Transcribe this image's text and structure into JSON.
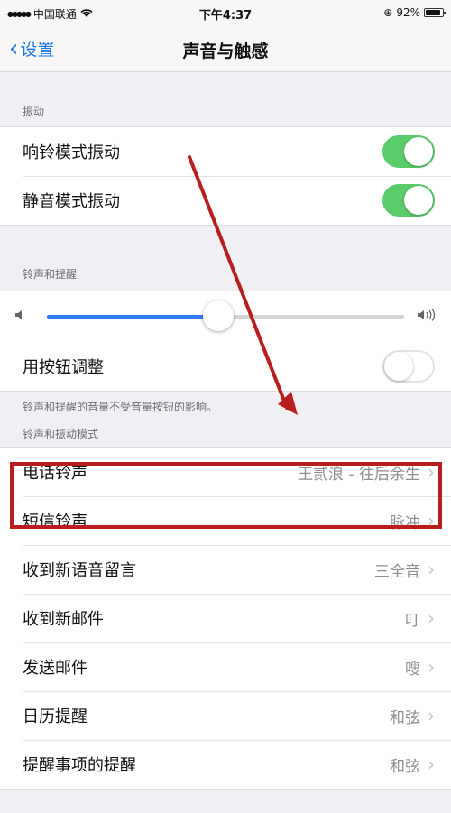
{
  "status_bar": {
    "carrier": "中国联通",
    "time": "下午4:37",
    "battery": "92%"
  },
  "nav": {
    "back_label": "设置",
    "title": "声音与触感"
  },
  "vibrate_section": {
    "header": "振动",
    "items": [
      {
        "label": "响铃模式振动",
        "state": "on"
      },
      {
        "label": "静音模式振动",
        "state": "on"
      }
    ]
  },
  "ringer_section": {
    "header": "铃声和提醒",
    "volume_level": 0.48,
    "adjust_label": "用按钮调整",
    "adjust_state": "off",
    "footer": "铃声和提醒的音量不受音量按钮的影响。"
  },
  "patterns_section": {
    "header": "铃声和振动模式",
    "items": [
      {
        "label": "电话铃声",
        "value": "王贰浪 - 往后余生"
      },
      {
        "label": "短信铃声",
        "value": "脉冲"
      },
      {
        "label": "收到新语音留言",
        "value": "三全音"
      },
      {
        "label": "收到新邮件",
        "value": "叮"
      },
      {
        "label": "发送邮件",
        "value": "嗖"
      },
      {
        "label": "日历提醒",
        "value": "和弦"
      },
      {
        "label": "提醒事项的提醒",
        "value": "和弦"
      }
    ]
  },
  "icons": {
    "back": "chevron-left-icon",
    "chevron": "chevron-right-icon",
    "volume_low": "speaker-low-icon",
    "volume_high": "speaker-high-icon"
  },
  "colors": {
    "accent": "#1a73e8",
    "toggle_on": "#5bcc6a",
    "slider_fill": "#2f7cf6",
    "annotation": "#b81e1e"
  }
}
